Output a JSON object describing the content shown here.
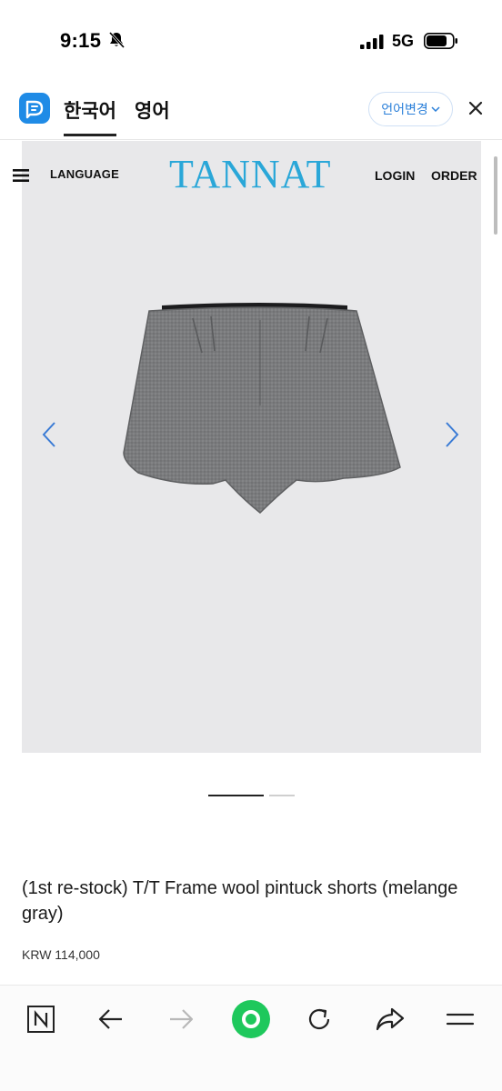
{
  "status_bar": {
    "time": "9:15",
    "network": "5G"
  },
  "translate_bar": {
    "source_tab": "한국어",
    "target_tab": "영어",
    "change_button": "언어변경",
    "accent_color": "#1f8be6"
  },
  "site": {
    "nav": {
      "language": "LANGUAGE",
      "brand": "TANNAT",
      "login": "LOGIN",
      "order": "ORDER"
    },
    "carousel": {
      "current_slide": 1,
      "total_slides": 2
    },
    "product": {
      "title": "(1st re-stock) T/T Frame wool pintuck shorts (melange gray)",
      "price": "KRW 114,000"
    },
    "brand_color": "#2aa7d8"
  },
  "toolbar": {
    "items": [
      "n-home-icon",
      "back-icon",
      "forward-icon",
      "green-dot-icon",
      "reload-icon",
      "share-icon",
      "menu-icon"
    ],
    "green_color": "#1ec85c"
  }
}
